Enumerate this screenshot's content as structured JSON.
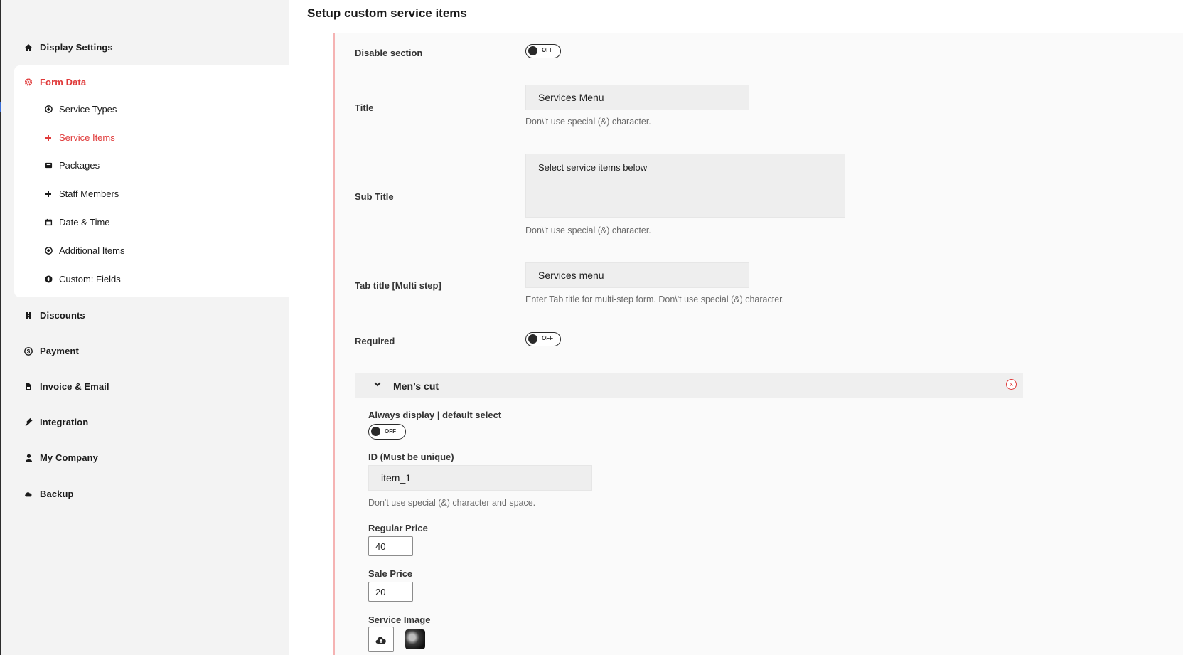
{
  "sidebar": {
    "items": [
      {
        "label": "Display Settings",
        "icon": "home-icon"
      },
      {
        "label": "Form Data",
        "icon": "gear-icon",
        "active": true
      },
      {
        "label": "Discounts",
        "icon": "discount-icon"
      },
      {
        "label": "Payment",
        "icon": "dollar-icon"
      },
      {
        "label": "Invoice & Email",
        "icon": "document-icon"
      },
      {
        "label": "Integration",
        "icon": "plug-icon"
      },
      {
        "label": "My Company",
        "icon": "user-icon"
      },
      {
        "label": "Backup",
        "icon": "cloud-icon"
      }
    ],
    "form_data_sub": [
      {
        "label": "Service Types",
        "icon": "plus-circle-icon"
      },
      {
        "label": "Service Items",
        "icon": "plus-icon",
        "active": true
      },
      {
        "label": "Packages",
        "icon": "package-icon"
      },
      {
        "label": "Staff Members",
        "icon": "plus-icon"
      },
      {
        "label": "Date & Time",
        "icon": "calendar-icon"
      },
      {
        "label": "Additional Items",
        "icon": "plus-circle-icon"
      },
      {
        "label": "Custom: Fields",
        "icon": "plus-circle-filled-icon"
      }
    ]
  },
  "main": {
    "title": "Setup custom service items",
    "disable_section": {
      "label": "Disable section",
      "toggle": "OFF"
    },
    "title_field": {
      "label": "Title",
      "value": "Services Menu",
      "hint": "Don\\'t use special (&) character."
    },
    "subtitle_field": {
      "label": "Sub Title",
      "value": "Select service items below",
      "hint": "Don\\'t use special (&) character."
    },
    "tab_title_field": {
      "label": "Tab title [Multi step]",
      "value": "Services menu",
      "hint": "Enter Tab title for multi-step form. Don\\'t use special (&) character."
    },
    "required": {
      "label": "Required",
      "toggle": "OFF"
    },
    "item": {
      "title": "Men’s cut",
      "remove_label": "x",
      "always_display": {
        "label": "Always display | default select",
        "toggle": "OFF"
      },
      "id_field": {
        "label": "ID (Must be unique)",
        "value": "item_1",
        "hint": "Don't use special (&) character and space."
      },
      "regular_price": {
        "label": "Regular Price",
        "value": "40"
      },
      "sale_price": {
        "label": "Sale Price",
        "value": "20"
      },
      "image": {
        "label": "Service Image",
        "upload_icon": "cloud-upload-icon"
      }
    }
  },
  "colors": {
    "accent": "#e03a3a",
    "divider": "#f5b3b3",
    "field_bg": "#eeeeee"
  }
}
